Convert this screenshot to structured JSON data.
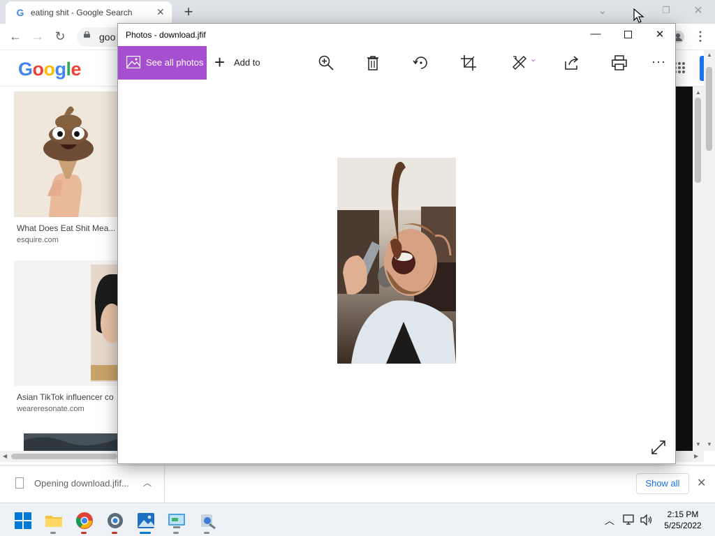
{
  "browser": {
    "tab": {
      "title": "eating shit - Google Search",
      "favicon": "G"
    },
    "address_partial": "goo",
    "new_tab_glyph": "+",
    "close_glyph": "✕",
    "nav": {
      "back": "←",
      "forward": "→",
      "reload": "↻"
    }
  },
  "google": {
    "logo": [
      "G",
      "o",
      "o",
      "g",
      "l",
      "e"
    ],
    "logo_colors": [
      "#4285f4",
      "#ea4335",
      "#fbbc05",
      "#4285f4",
      "#34a853",
      "#ea4335"
    ]
  },
  "results": [
    {
      "title": "What Does Eat Shit Mea...",
      "source": "esquire.com"
    },
    {
      "title": "Asian TikTok influencer co",
      "source": "weareresonate.com"
    }
  ],
  "download_bar": {
    "item_label": "Opening download.jfif...",
    "show_all": "Show all",
    "close": "✕"
  },
  "photos": {
    "title": "Photos - download.jfif",
    "see_all_photos": "See all photos",
    "add_to": "Add to",
    "more": "···",
    "accent": "#a64fd1"
  },
  "taskbar": {
    "time": "2:15 PM",
    "date": "5/25/2022"
  }
}
